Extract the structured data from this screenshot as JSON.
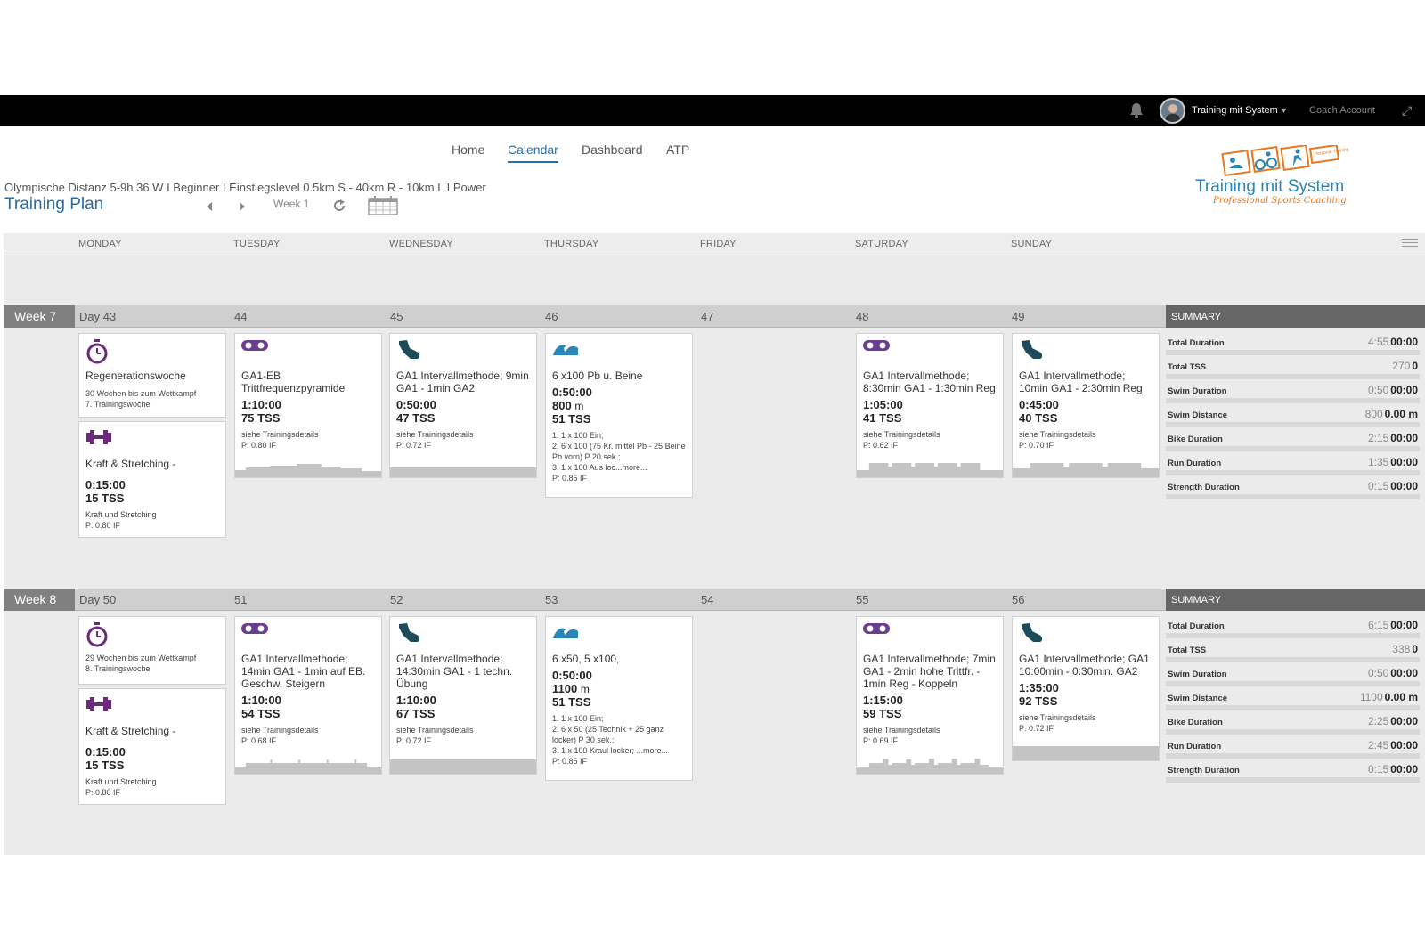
{
  "topbar": {
    "user_name": "Training mit System",
    "coach_account": "Coach Account"
  },
  "nav": {
    "items": [
      "Home",
      "Calendar",
      "Dashboard",
      "ATP"
    ],
    "active": "Calendar"
  },
  "plan": {
    "subtitle": "Olympische Distanz 5-9h 36 W I Beginner I Einstiegslevel 0.5km S - 40km R - 10km L I Power",
    "title": "Training Plan",
    "week_indicator": "Week 1"
  },
  "logo": {
    "title": "Training mit System",
    "tagline": "Professional Sports Coaching",
    "badge": "Personal Training"
  },
  "days": [
    "MONDAY",
    "TUESDAY",
    "WEDNESDAY",
    "THURSDAY",
    "FRIDAY",
    "SATURDAY",
    "SUNDAY"
  ],
  "weeks": [
    {
      "label": "Week 7",
      "day_nums": [
        "Day 43",
        "44",
        "45",
        "46",
        "47",
        "48",
        "49"
      ],
      "summary_title": "SUMMARY",
      "summary": [
        {
          "label": "Total Duration",
          "planned": "4:55",
          "actual": "00:00"
        },
        {
          "label": "Total TSS",
          "planned": "270",
          "actual": "0"
        },
        {
          "label": "Swim Duration",
          "planned": "0:50",
          "actual": "00:00"
        },
        {
          "label": "Swim Distance",
          "planned": "800",
          "actual": "0.00 m"
        },
        {
          "label": "Bike Duration",
          "planned": "2:15",
          "actual": "00:00"
        },
        {
          "label": "Run Duration",
          "planned": "1:35",
          "actual": "00:00"
        },
        {
          "label": "Strength Duration",
          "planned": "0:15",
          "actual": "00:00"
        }
      ],
      "cards": {
        "mon_note": {
          "title": "Regenerationswoche",
          "line1": "30 Wochen bis zum Wettkampf",
          "line2": "7. Trainingswoche"
        },
        "mon_strength": {
          "title": "Kraft & Stretching -",
          "duration": "0:15:00",
          "tss": "15",
          "desc": "Kraft und Stretching",
          "intensity": "P: 0.80 IF"
        },
        "tue": {
          "title": "GA1-EB Trittfrequenzpyramide",
          "duration": "1:10:00",
          "tss": "75",
          "desc": "siehe Trainingsdetails",
          "intensity": "P: 0.80 IF"
        },
        "wed": {
          "title": "GA1 Intervallmethode; 9min GA1 - 1min GA2",
          "duration": "0:50:00",
          "tss": "47",
          "desc": "siehe Trainingsdetails",
          "intensity": "P: 0.72 IF"
        },
        "thu": {
          "title": "6 x100 Pb u. Beine",
          "duration": "0:50:00",
          "distance": "800",
          "dist_unit": "m",
          "tss": "51",
          "d1": "1. 1 x 100 Ein;",
          "d2": "2. 6 x 100 (75 Kr. mittel Pb - 25 Beine Pb vorn) P 20 sek.;",
          "d3": "3. 1 x 100 Aus loc...more...",
          "intensity": "P: 0.85 IF"
        },
        "sat": {
          "title": "GA1 Intervallmethode; 8:30min GA1 - 1:30min Reg",
          "duration": "1:05:00",
          "tss": "41",
          "desc": "siehe Trainingsdetails",
          "intensity": "P: 0.62 IF"
        },
        "sun": {
          "title": "GA1 Intervallmethode; 10min GA1 - 2:30min Reg",
          "duration": "0:45:00",
          "tss": "40",
          "desc": "siehe Trainingsdetails",
          "intensity": "P: 0.70 IF"
        }
      }
    },
    {
      "label": "Week 8",
      "day_nums": [
        "Day 50",
        "51",
        "52",
        "53",
        "54",
        "55",
        "56"
      ],
      "summary_title": "SUMMARY",
      "summary": [
        {
          "label": "Total Duration",
          "planned": "6:15",
          "actual": "00:00"
        },
        {
          "label": "Total TSS",
          "planned": "338",
          "actual": "0"
        },
        {
          "label": "Swim Duration",
          "planned": "0:50",
          "actual": "00:00"
        },
        {
          "label": "Swim Distance",
          "planned": "1100",
          "actual": "0.00 m"
        },
        {
          "label": "Bike Duration",
          "planned": "2:25",
          "actual": "00:00"
        },
        {
          "label": "Run Duration",
          "planned": "2:45",
          "actual": "00:00"
        },
        {
          "label": "Strength Duration",
          "planned": "0:15",
          "actual": "00:00"
        }
      ],
      "cards": {
        "mon_note": {
          "line1": "29 Wochen bis zum Wettkampf",
          "line2": "8. Trainingswoche"
        },
        "mon_strength": {
          "title": "Kraft & Stretching -",
          "duration": "0:15:00",
          "tss": "15",
          "desc": "Kraft und Stretching",
          "intensity": "P: 0.80 IF"
        },
        "tue": {
          "title": "GA1 Intervallmethode; 14min GA1 - 1min auf EB. Geschw. Steigern",
          "duration": "1:10:00",
          "tss": "54",
          "desc": "siehe Trainingsdetails",
          "intensity": "P: 0.68 IF"
        },
        "wed": {
          "title": "GA1 Intervallmethode; 14:30min GA1 - 1 techn. Übung",
          "duration": "1:10:00",
          "tss": "67",
          "desc": "siehe Trainingsdetails",
          "intensity": "P: 0.72 IF"
        },
        "thu": {
          "title": "6 x50, 5 x100,",
          "duration": "0:50:00",
          "distance": "1100",
          "dist_unit": "m",
          "tss": "51",
          "d1": "1. 1 x 100 Ein;",
          "d2": "2. 6 x 50 (25 Technik + 25 ganz locker) P 30 sek.;",
          "d3": "3. 1 x 100 Kraul locker; ...more...",
          "intensity": "P: 0.85 IF"
        },
        "sat": {
          "title": "GA1 Intervallmethode; 7min GA1 - 2min hohe Trittfr. - 1min Reg - Koppeln",
          "duration": "1:15:00",
          "tss": "59",
          "desc": "siehe Trainingsdetails",
          "intensity": "P: 0.69 IF"
        },
        "sun": {
          "title": "GA1 Intervallmethode; GA1 10:00min - 0:30min. GA2",
          "duration": "1:35:00",
          "tss": "92",
          "desc": "siehe Trainingsdetails",
          "intensity": "P: 0.72 IF"
        }
      }
    }
  ],
  "tss_unit": "TSS",
  "colors": {
    "accent": "#2b6ca3",
    "strength_purple": "#6b2a7a",
    "bike_purple": "#6a3d8f",
    "run_teal": "#1d4b5a",
    "swim_blue": "#2a86b8",
    "logo_orange": "#e87722"
  }
}
